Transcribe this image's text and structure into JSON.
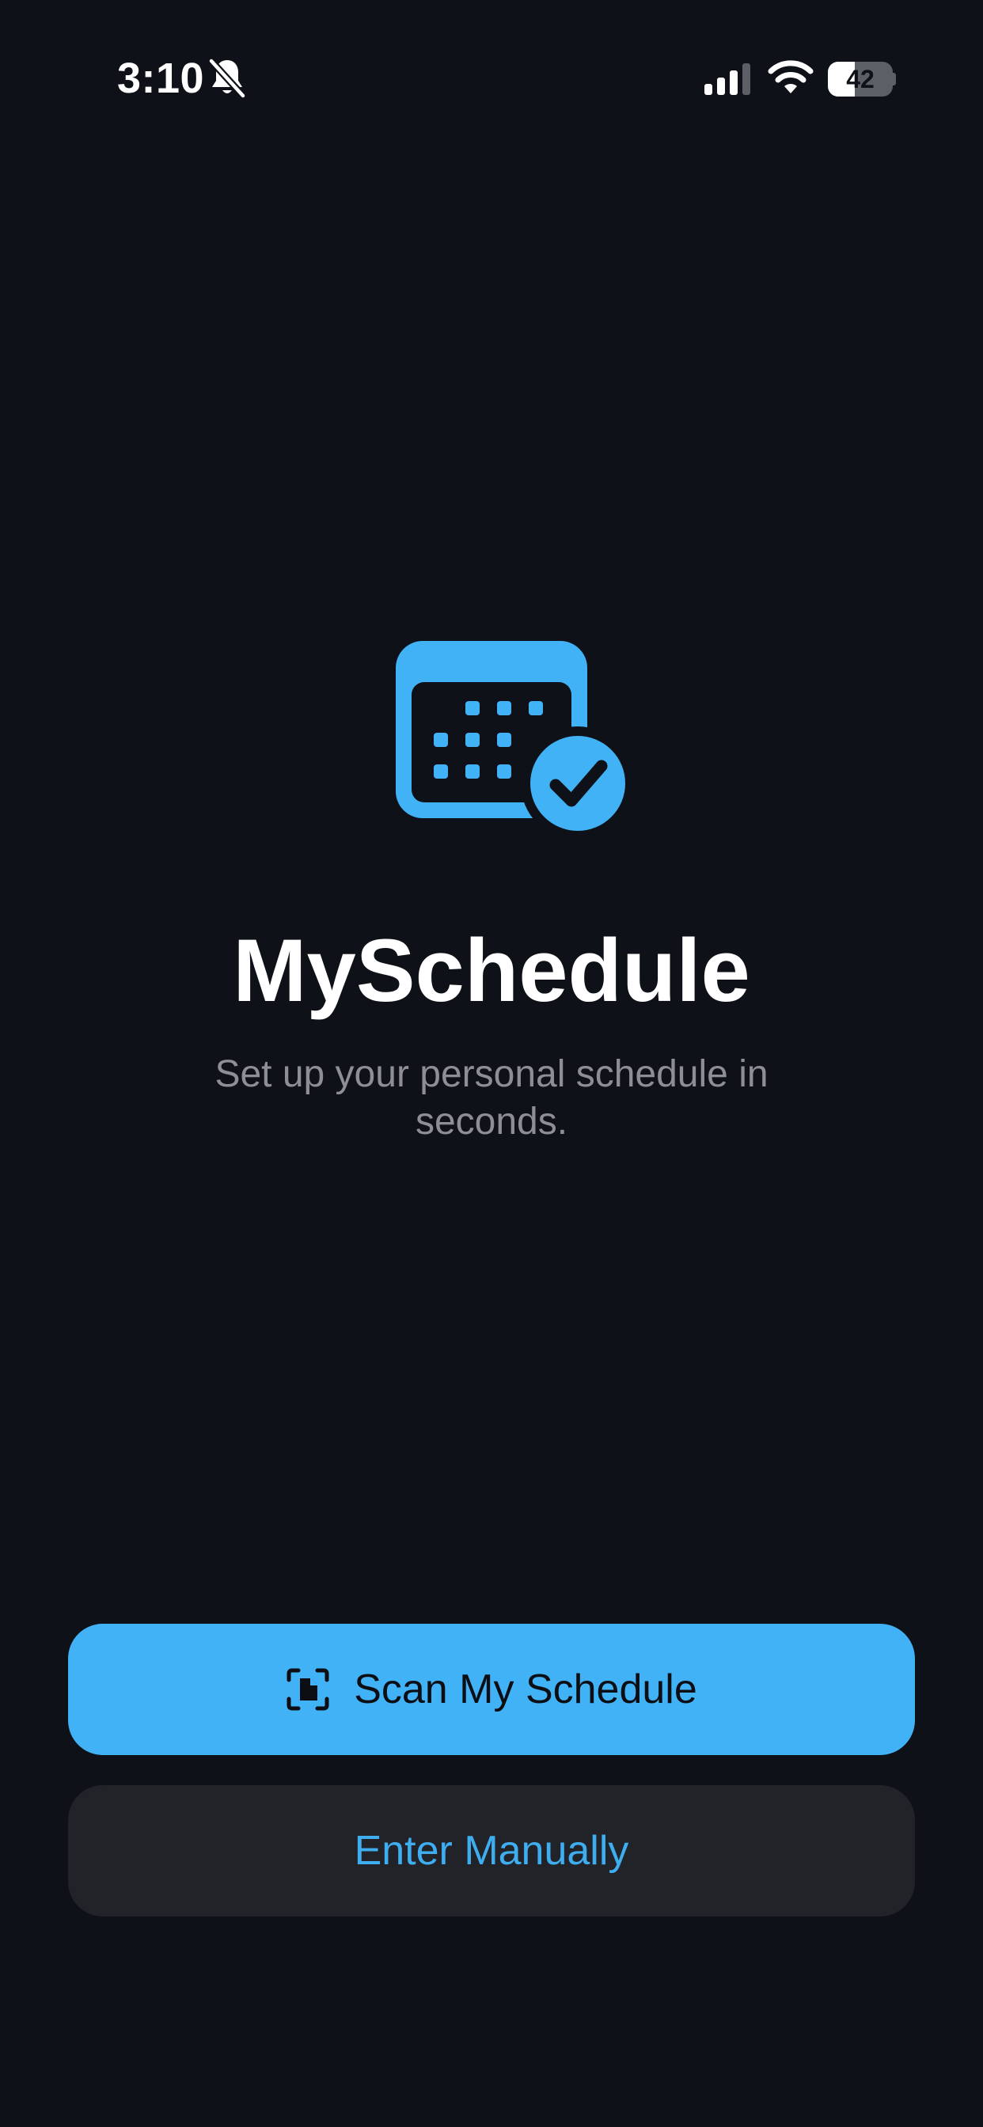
{
  "status_bar": {
    "time": "3:10",
    "battery_level": "42",
    "battery_fraction": 0.42,
    "icons": [
      "bell-slash-icon",
      "cellular-signal-icon",
      "wifi-icon",
      "battery-icon"
    ]
  },
  "app": {
    "logo_icon": "calendar-check-icon",
    "title": "MySchedule",
    "subtitle": "Set up your personal schedule in seconds."
  },
  "actions": {
    "scan_label": "Scan My Schedule",
    "scan_icon": "document-scanner-icon",
    "manual_label": "Enter Manually"
  },
  "colors": {
    "background": "#0f1118",
    "accent": "#40b2f5",
    "secondary_button": "#222329",
    "subtitle_text": "#8e8f96"
  }
}
